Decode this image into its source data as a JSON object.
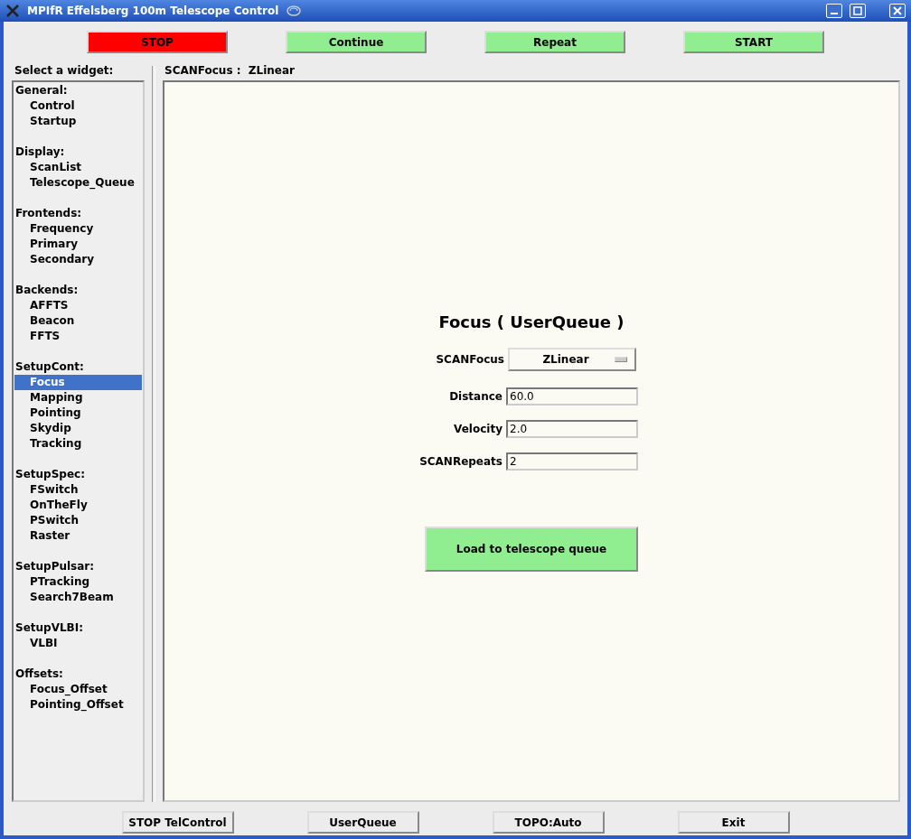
{
  "window": {
    "title": "MPIfR Effelsberg 100m Telescope Control"
  },
  "top_buttons": [
    {
      "label": "STOP",
      "kind": "danger"
    },
    {
      "label": "Continue",
      "kind": "go"
    },
    {
      "label": "Repeat",
      "kind": "go"
    },
    {
      "label": "START",
      "kind": "go"
    }
  ],
  "sidebar": {
    "title": "Select a widget:",
    "groups": [
      {
        "label": "General:",
        "items": [
          {
            "label": "Control",
            "selected": false
          },
          {
            "label": "Startup",
            "selected": false
          }
        ]
      },
      {
        "label": "Display:",
        "items": [
          {
            "label": "ScanList",
            "selected": false
          },
          {
            "label": "Telescope_Queue",
            "selected": false
          }
        ]
      },
      {
        "label": "Frontends:",
        "items": [
          {
            "label": "Frequency",
            "selected": false
          },
          {
            "label": "Primary",
            "selected": false
          },
          {
            "label": "Secondary",
            "selected": false
          }
        ]
      },
      {
        "label": "Backends:",
        "items": [
          {
            "label": "AFFTS",
            "selected": false
          },
          {
            "label": "Beacon",
            "selected": false
          },
          {
            "label": "FFTS",
            "selected": false
          }
        ]
      },
      {
        "label": "SetupCont:",
        "items": [
          {
            "label": "Focus",
            "selected": true
          },
          {
            "label": "Mapping",
            "selected": false
          },
          {
            "label": "Pointing",
            "selected": false
          },
          {
            "label": "Skydip",
            "selected": false
          },
          {
            "label": "Tracking",
            "selected": false
          }
        ]
      },
      {
        "label": "SetupSpec:",
        "items": [
          {
            "label": "FSwitch",
            "selected": false
          },
          {
            "label": "OnTheFly",
            "selected": false
          },
          {
            "label": "PSwitch",
            "selected": false
          },
          {
            "label": "Raster",
            "selected": false
          }
        ]
      },
      {
        "label": "SetupPulsar:",
        "items": [
          {
            "label": "PTracking",
            "selected": false
          },
          {
            "label": "Search7Beam",
            "selected": false
          }
        ]
      },
      {
        "label": "SetupVLBI:",
        "items": [
          {
            "label": "VLBI",
            "selected": false
          }
        ]
      },
      {
        "label": "Offsets:",
        "items": [
          {
            "label": "Focus_Offset",
            "selected": false
          },
          {
            "label": "Pointing_Offset",
            "selected": false
          }
        ]
      }
    ]
  },
  "content": {
    "breadcrumb": "SCANFocus :  ZLinear",
    "heading": "Focus ( UserQueue )",
    "fields": [
      {
        "label": "SCANFocus",
        "kind": "dropdown",
        "value": "ZLinear"
      },
      {
        "label": "Distance",
        "kind": "text",
        "value": "60.0"
      },
      {
        "label": "Velocity",
        "kind": "text",
        "value": "2.0"
      },
      {
        "label": "SCANRepeats",
        "kind": "text",
        "value": "2"
      }
    ],
    "action": "Load to telescope queue"
  },
  "bottom_buttons": [
    "STOP TelControl",
    "UserQueue",
    "TOPO:Auto",
    "Exit"
  ]
}
